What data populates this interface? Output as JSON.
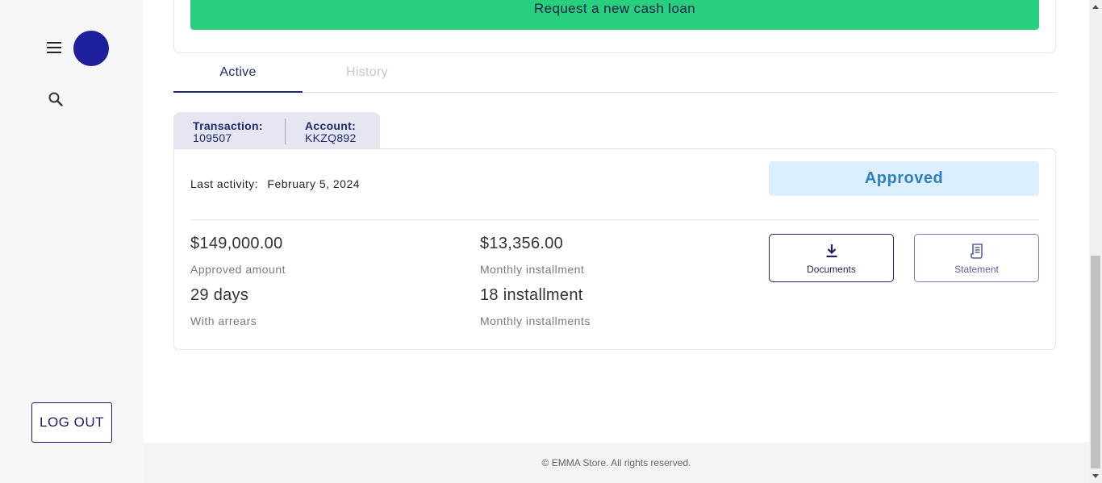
{
  "sidebar": {
    "menu_icon": "hamburger-menu-icon",
    "avatar_color": "#1e1f9a",
    "search_icon": "search-icon",
    "logout_label": "LOG OUT"
  },
  "header": {
    "request_button_label": "Request a new cash loan",
    "request_button_color": "#28d07e"
  },
  "tabs": [
    {
      "label": "Active",
      "active": true
    },
    {
      "label": "History",
      "active": false
    }
  ],
  "loan": {
    "transaction_label": "Transaction:",
    "transaction_value": "109507",
    "account_label": "Account:",
    "account_value": "KKZQ892",
    "last_activity_label": "Last activity:",
    "last_activity_date": "February 5, 2024",
    "status": "Approved",
    "status_color": "#2f7fc1",
    "metrics": {
      "approved_amount_value": "$149,000.00",
      "approved_amount_label": "Approved amount",
      "monthly_installment_value": "$13,356.00",
      "monthly_installment_label": "Monthly installment",
      "arrears_value": "29 days",
      "arrears_label": "With arrears",
      "installments_value": "18 installment",
      "installments_label": "Monthly installments"
    },
    "actions": {
      "documents_label": "Documents",
      "documents_icon": "download-icon",
      "statement_label": "Statement",
      "statement_icon": "receipt-icon"
    }
  },
  "footer": {
    "copyright": "© EMMA Store. All rights reserved."
  }
}
